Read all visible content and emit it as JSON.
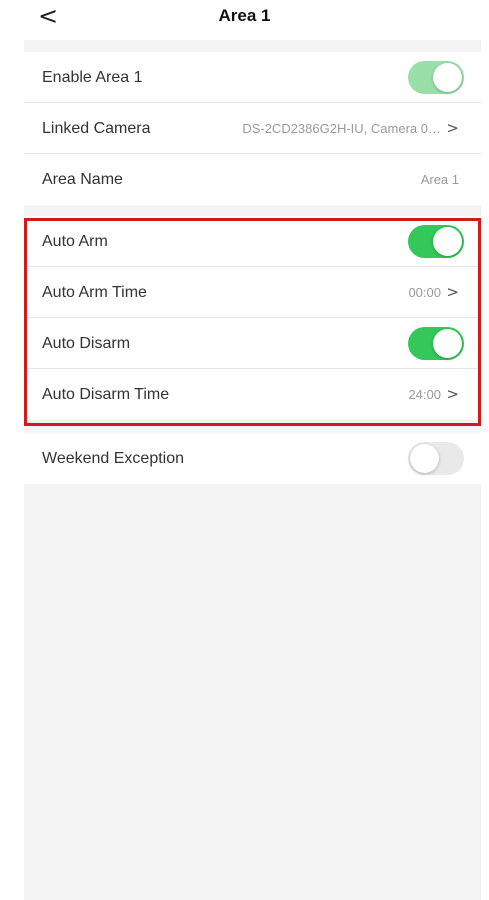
{
  "header": {
    "back_icon": "chevron-left-icon",
    "back_glyph": "<",
    "title": "Area 1"
  },
  "group1": {
    "enable": {
      "label": "Enable Area 1",
      "toggle_on": true
    },
    "linked_camera": {
      "label": "Linked Camera",
      "value": "DS-2CD2386G2H-IU, Camera 0…",
      "chevron": ">"
    },
    "area_name": {
      "label": "Area Name",
      "value": "Area 1"
    }
  },
  "group2": {
    "auto_arm": {
      "label": "Auto Arm",
      "toggle_on": true
    },
    "auto_arm_time": {
      "label": "Auto Arm Time",
      "value": "00:00",
      "chevron": ">"
    },
    "auto_disarm": {
      "label": "Auto Disarm",
      "toggle_on": true
    },
    "auto_disarm_time": {
      "label": "Auto Disarm Time",
      "value": "24:00",
      "chevron": ">"
    }
  },
  "group3": {
    "weekend_exception": {
      "label": "Weekend Exception",
      "toggle_on": false
    }
  },
  "colors": {
    "toggle_on": "#34c759",
    "toggle_on_dimmed": "#9adfaa",
    "toggle_off": "#e9e9ea",
    "highlight_border": "#d11a1a",
    "background": "#f4f4f4"
  }
}
